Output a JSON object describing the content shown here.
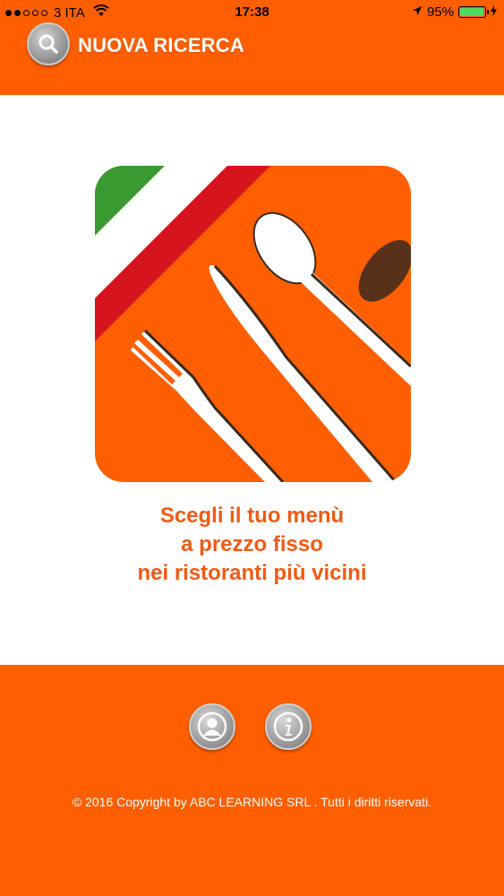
{
  "status_bar": {
    "carrier": "3 ITA",
    "time": "17:38",
    "battery_percent": "95%",
    "signal_bars_filled": 2,
    "signal_bars_total": 5,
    "battery_level": 0.95,
    "battery_color": "#4cd964"
  },
  "header": {
    "title": "NUOVA RICERCA",
    "search_icon": "search-icon",
    "background": "#ff5f00"
  },
  "logo": {
    "icon": "fork-knife-spoon-logo",
    "colors": {
      "orange": "#ff5f00",
      "green": "#3a9a32",
      "red": "#d7141e",
      "white": "#ffffff"
    }
  },
  "tagline": {
    "line1": "Scegli il tuo menù",
    "line2": "a prezzo fisso",
    "line3": "nei ristoranti più vicini",
    "color": "#f05a14"
  },
  "footer": {
    "profile_icon": "user-profile-icon",
    "info_icon": "info-icon",
    "copyright": "© 2016 Copyright by ABC LEARNING SRL . Tutti i diritti riservati.",
    "background": "#ff5f00"
  }
}
